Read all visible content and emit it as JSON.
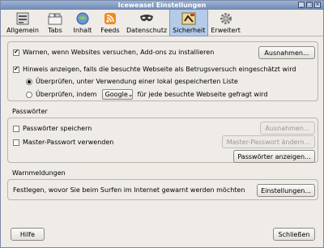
{
  "window": {
    "title": "Iceweasel Einstellungen"
  },
  "toolbar": {
    "items": [
      {
        "label": "Allgemein",
        "icon": "general-icon"
      },
      {
        "label": "Tabs",
        "icon": "tabs-icon"
      },
      {
        "label": "Inhalt",
        "icon": "content-icon"
      },
      {
        "label": "Feeds",
        "icon": "feeds-icon"
      },
      {
        "label": "Datenschutz",
        "icon": "privacy-mask-icon"
      },
      {
        "label": "Sicherheit",
        "icon": "security-icon"
      },
      {
        "label": "Erweitert",
        "icon": "advanced-gear-icon"
      }
    ],
    "active": "Sicherheit"
  },
  "security": {
    "warn_addons": {
      "label": "Warnen, wenn Websites versuchen, Add-ons zu installieren",
      "checked": true
    },
    "exceptions_button": "Ausnahmen...",
    "warn_fraud": {
      "label": "Hinweis anzeigen, falls die besuchte Webseite als Betrugsversuch eingeschätzt wird",
      "checked": true
    },
    "radio_local": {
      "label": "Überprüfen, unter Verwendung einer lokal gespeicherten Liste",
      "selected": true
    },
    "radio_remote_prefix": "Überprüfen, indem",
    "radio_remote_select": "Google",
    "radio_remote_suffix": "für jede besuchte Webseite gefragt wird"
  },
  "passwords": {
    "title": "Passwörter",
    "save": {
      "label": "Passwörter speichern",
      "checked": false
    },
    "exceptions_button": "Ausnahmen...",
    "master": {
      "label": "Master-Passwort verwenden",
      "checked": false
    },
    "change_master_button": "Master-Passwort ändern...",
    "show_button": "Passwörter anzeigen..."
  },
  "warnings": {
    "title": "Warnmeldungen",
    "text": "Festlegen, wovor Sie beim Surfen im Internet gewarnt werden möchten",
    "settings_button": "Einstellungen..."
  },
  "footer": {
    "help_button": "Hilfe",
    "close_button": "Schließen"
  },
  "colors": {
    "active_tab": "#b5cbe8",
    "titlebar": "#6f88b4",
    "background": "#efebe7"
  }
}
